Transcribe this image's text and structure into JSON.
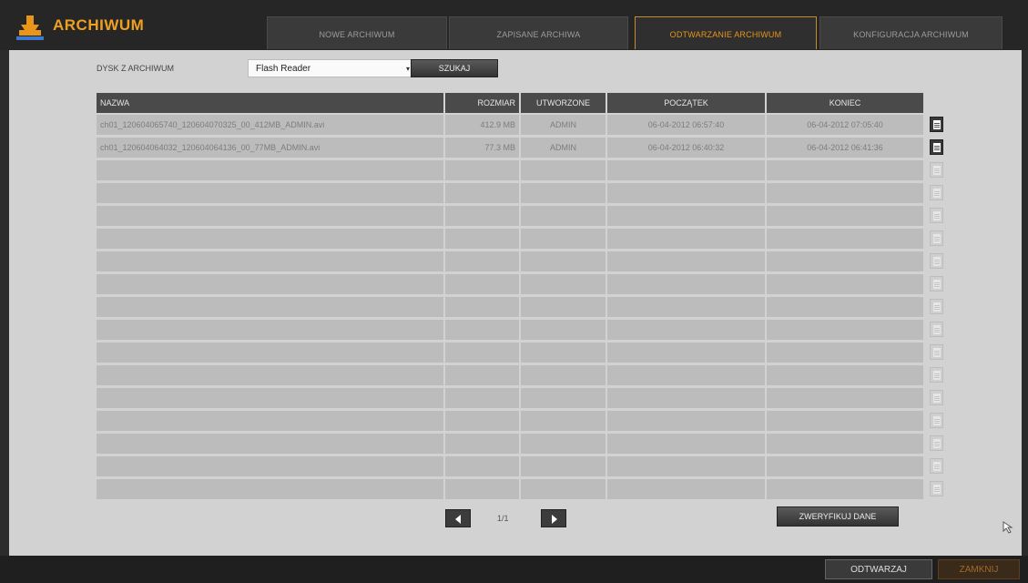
{
  "app": {
    "title": "ARCHIWUM"
  },
  "tabs": [
    {
      "label": "NOWE ARCHIWUM"
    },
    {
      "label": "ZAPISANE ARCHIWA"
    },
    {
      "label": "ODTWARZANIE ARCHIWUM",
      "active": true
    },
    {
      "label": "KONFIGURACJA ARCHIWUM"
    }
  ],
  "disk": {
    "label": "DYSK Z ARCHIWUM",
    "selected": "Flash Reader",
    "search_label": "SZUKAJ"
  },
  "table": {
    "headers": {
      "name": "NAZWA",
      "size": "ROZMIAR",
      "created": "UTWORZONE",
      "start": "POCZĄTEK",
      "end": "KONIEC"
    },
    "rows": [
      {
        "name": "ch01_120604065740_120604070325_00_412MB_ADMIN.avi",
        "size": "412.9 MB",
        "created": "ADMIN",
        "start": "06-04-2012 06:57:40",
        "end": "06-04-2012 07:05:40"
      },
      {
        "name": "ch01_120604064032_120604064136_00_77MB_ADMIN.avi",
        "size": "77.3 MB",
        "created": "ADMIN",
        "start": "06-04-2012 06:40:32",
        "end": "06-04-2012 06:41:36"
      }
    ],
    "empty_rows": 15
  },
  "pager": {
    "page": "1/1"
  },
  "verify_label": "ZWERYFIKUJ DANE",
  "footer": {
    "play_label": "ODTWARZAJ",
    "close_label": "ZAMKNIJ"
  },
  "colors": {
    "accent": "#f0a020",
    "header_bg": "#4a4a4a",
    "row_bg": "#bcbcbc",
    "panel_bg": "#d2d2d2"
  },
  "icons": {
    "logo": "archive-stamp-icon",
    "row_action": "document-icon",
    "cursor": "mouse-cursor-icon"
  }
}
